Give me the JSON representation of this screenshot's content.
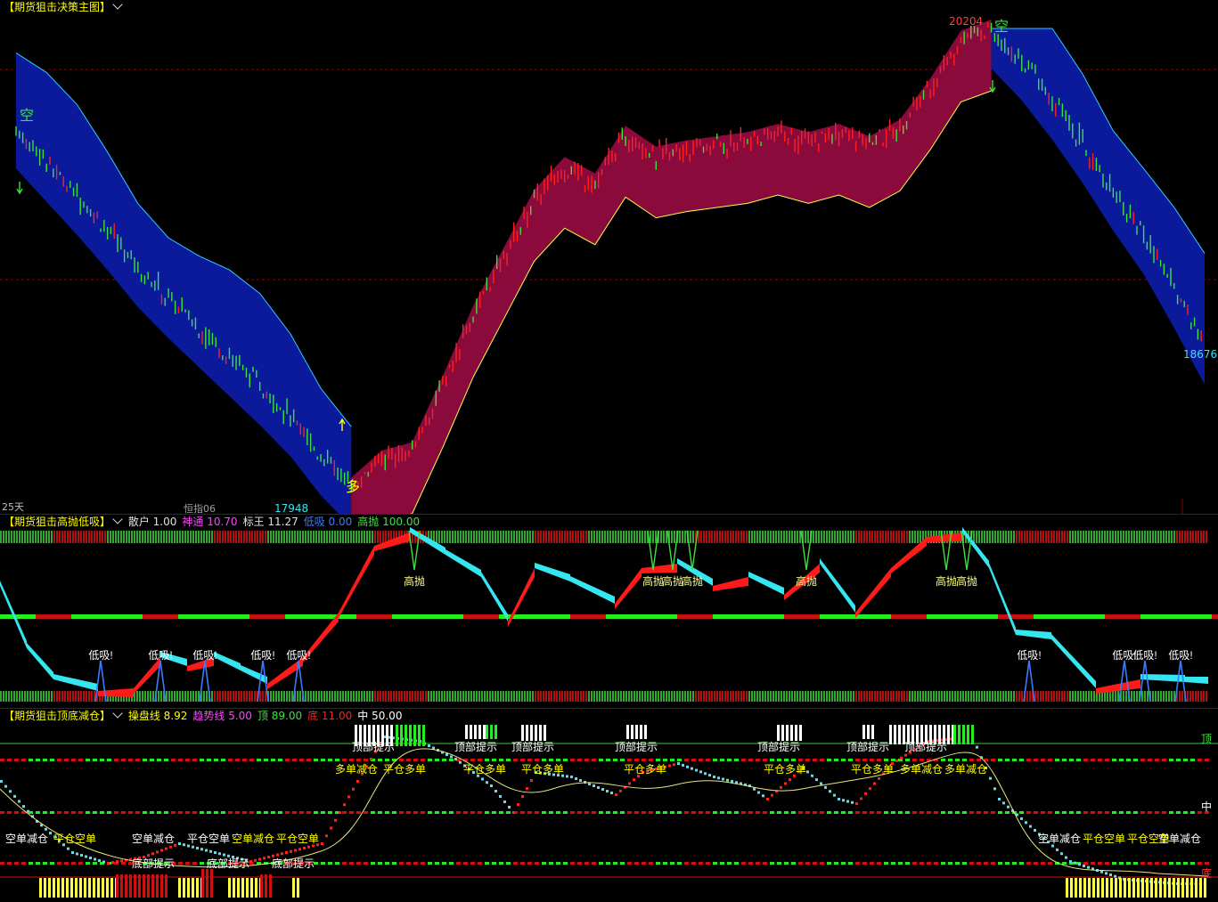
{
  "colors": {
    "bg": "#000000",
    "bull": "#ff2020",
    "bear": "#3ee03e",
    "cyan": "#35e6f0",
    "yellow": "#ffff00",
    "blueBand": "#0a1a9a",
    "redBand": "#8b0a3c",
    "grid": "#8b0000",
    "magenta": "#ff44ff"
  },
  "main": {
    "title": "【期货狙击决策主图】",
    "chev_icon": "chevron-down-icon",
    "high_label": "20204",
    "low_label": "17948",
    "last_label": "18676",
    "short_mark": "空",
    "long_mark": "多",
    "period_label": "25天",
    "index_label": "恒指06"
  },
  "panel2": {
    "title": "【期货狙击高抛低吸】",
    "indicators": [
      {
        "name": "散户",
        "value": "1.00",
        "color": "#e0e0e0"
      },
      {
        "name": "神通",
        "value": "10.70",
        "color": "#ff44ff"
      },
      {
        "name": "标王",
        "value": "11.27",
        "color": "#e0e0e0"
      },
      {
        "name": "低吸",
        "value": "0.00",
        "color": "#3a7bff"
      },
      {
        "name": "高抛",
        "value": "100.00",
        "color": "#3ee03e"
      }
    ],
    "sell_label": "高抛",
    "buy_label": "低吸!"
  },
  "panel3": {
    "title": "【期货狙击顶底减仓】",
    "indicators": [
      {
        "name": "操盘线",
        "value": "8.92",
        "color": "#ffff00"
      },
      {
        "name": "趋势线",
        "value": "5.00",
        "color": "#ff44ff"
      },
      {
        "name": "顶",
        "value": "89.00",
        "color": "#3ee03e"
      },
      {
        "name": "底",
        "value": "11.00",
        "color": "#ff2020"
      },
      {
        "name": "中",
        "value": "50.00",
        "color": "#ffffff"
      }
    ],
    "top_hint": "顶部提示",
    "bottom_hint": "底部提示",
    "right_top": "顶",
    "right_mid": "中",
    "right_bottom": "底",
    "long_close": "平仓多单",
    "long_open": "多单减仓",
    "short_open": "空单减仓",
    "short_close": "平仓空单"
  },
  "chart_data": [
    {
      "type": "candlestick",
      "title": "【期货狙击决策主图】",
      "price_high": 20204,
      "price_low": 17948,
      "price_last": 18676,
      "path": [
        19720,
        19560,
        19400,
        19230,
        19050,
        18900,
        18760,
        18620,
        18480,
        18330,
        18140,
        17990,
        18120,
        18160,
        18480,
        18820,
        19100,
        19380,
        19540,
        19460,
        19690,
        19590,
        19620,
        19640,
        19660,
        19700,
        19660,
        19700,
        19640,
        19720,
        19920,
        20150,
        20204,
        20050,
        19860,
        19650,
        19420,
        19210,
        18950,
        18676
      ]
    },
    {
      "type": "line",
      "title": "【期货狙击高抛低吸】",
      "ylim": [
        0,
        100
      ],
      "sell_label": "高抛",
      "buy_label": "低吸!"
    },
    {
      "type": "line",
      "title": "【期货狙击顶底减仓】",
      "ylim": [
        0,
        100
      ],
      "levels": {
        "top": 89,
        "mid": 50,
        "bottom": 11
      }
    }
  ]
}
